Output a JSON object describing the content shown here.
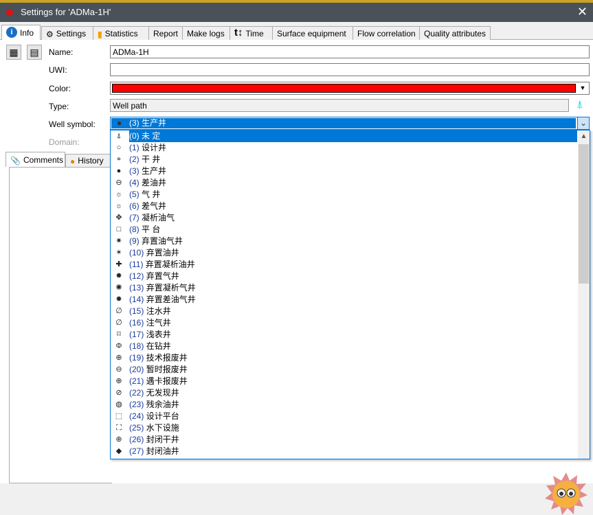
{
  "window": {
    "title": "Settings for 'ADMa-1H'",
    "close": "✕"
  },
  "tabs": [
    {
      "label": "Info",
      "icon": "info-icon"
    },
    {
      "label": "Settings",
      "icon": "settings-doc-icon"
    },
    {
      "label": "Statistics",
      "icon": "bar-chart-icon"
    },
    {
      "label": "Report"
    },
    {
      "label": "Make logs"
    },
    {
      "label": "Time",
      "icon": "time-icon"
    },
    {
      "label": "Surface equipment"
    },
    {
      "label": "Flow correlation"
    },
    {
      "label": "Quality attributes"
    }
  ],
  "form": {
    "name_label": "Name:",
    "name_value": "ADMa-1H",
    "uwi_label": "UWI:",
    "uwi_value": "",
    "color_label": "Color:",
    "color_value": "#ff0000",
    "type_label": "Type:",
    "type_value": "Well path",
    "symbol_label": "Well symbol:",
    "symbol_value": "(3) 生产井",
    "domain_label": "Domain:"
  },
  "subtabs": [
    {
      "label": "Comments",
      "icon": "paperclip-icon"
    },
    {
      "label": "History",
      "icon": "history-icon"
    }
  ],
  "colors": {
    "accent": "#0078d7",
    "titlebar": "#4a5159"
  },
  "symbols": [
    {
      "n": "(0)",
      "t": "未 定",
      "g": "⍋"
    },
    {
      "n": "(1)",
      "t": "设计井",
      "g": "○"
    },
    {
      "n": "(2)",
      "t": "干 井",
      "g": "⌖"
    },
    {
      "n": "(3)",
      "t": "生产井",
      "g": "●"
    },
    {
      "n": "(4)",
      "t": "差油井",
      "g": "⊖"
    },
    {
      "n": "(5)",
      "t": "气 井",
      "g": "☼"
    },
    {
      "n": "(6)",
      "t": "差气井",
      "g": "☼"
    },
    {
      "n": "(7)",
      "t": "凝析油气",
      "g": "✥"
    },
    {
      "n": "(8)",
      "t": "平 台",
      "g": "□"
    },
    {
      "n": "(9)",
      "t": "弃置油气井",
      "g": "✷"
    },
    {
      "n": "(10)",
      "t": "弃置油井",
      "g": "✶"
    },
    {
      "n": "(11)",
      "t": "弃置凝析油井",
      "g": "✚"
    },
    {
      "n": "(12)",
      "t": "弃置气井",
      "g": "✹"
    },
    {
      "n": "(13)",
      "t": "弃置凝析气井",
      "g": "✺"
    },
    {
      "n": "(14)",
      "t": "弃置差油气井",
      "g": "✹"
    },
    {
      "n": "(15)",
      "t": "注水井",
      "g": "∅"
    },
    {
      "n": "(16)",
      "t": "注气井",
      "g": "∅"
    },
    {
      "n": "(17)",
      "t": "浅表井",
      "g": "⌑"
    },
    {
      "n": "(18)",
      "t": "在钻井",
      "g": "Φ"
    },
    {
      "n": "(19)",
      "t": "技术报废井",
      "g": "⊕"
    },
    {
      "n": "(20)",
      "t": "暂时报废井",
      "g": "⊖"
    },
    {
      "n": "(21)",
      "t": "遇卡报废井",
      "g": "⊕"
    },
    {
      "n": "(22)",
      "t": "无发现井",
      "g": "⊘"
    },
    {
      "n": "(23)",
      "t": "残余油井",
      "g": "◍"
    },
    {
      "n": "(24)",
      "t": "设计平台",
      "g": "⬚"
    },
    {
      "n": "(25)",
      "t": "水下设施",
      "g": "⛶"
    },
    {
      "n": "(26)",
      "t": "封闭干井",
      "g": "⊕"
    },
    {
      "n": "(27)",
      "t": "封闭油井",
      "g": "◆"
    }
  ]
}
